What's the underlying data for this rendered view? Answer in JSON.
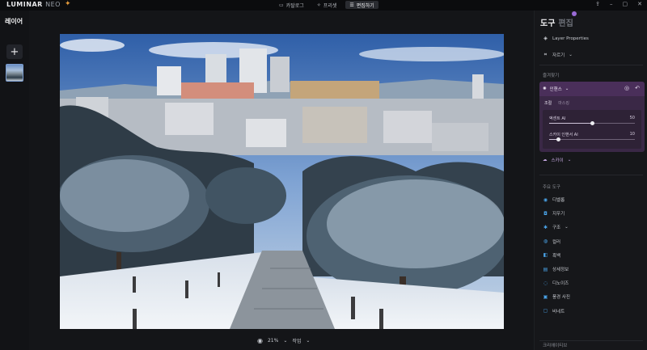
{
  "app": {
    "logo": "LUMINAR",
    "logo_suffix": "NEO"
  },
  "mode_tabs": [
    {
      "label": "카탈로그",
      "icon": "folder-icon"
    },
    {
      "label": "프리셋",
      "icon": "sparkle-icon"
    },
    {
      "label": "편집하기",
      "icon": "sliders-icon",
      "active": true
    }
  ],
  "layers": {
    "title": "레이어"
  },
  "canvas": {
    "zoom": "21%",
    "menu": "작업"
  },
  "right_panel": {
    "tabs": [
      {
        "label": "도구",
        "active": true
      },
      {
        "label": "편집"
      }
    ],
    "layer_properties": "Layer Properties",
    "crop": "자르기",
    "favorites_title": "즐겨찾기",
    "enhance": {
      "label": "인핸스",
      "subtabs": [
        "조절",
        "마스킹"
      ],
      "sliders": [
        {
          "label": "액센트 AI",
          "value": 50,
          "fraction": 0.5
        },
        {
          "label": "스카이 인핸서 AI",
          "value": 10,
          "fraction": 0.1
        }
      ]
    },
    "sky": "스카이",
    "main_tools_title": "주요 도구",
    "main_tools": [
      {
        "label": "디벨롭",
        "icon": "develop-icon",
        "color": "#4aa3e8"
      },
      {
        "label": "지우기",
        "icon": "erase-icon",
        "color": "#4aa3e8"
      },
      {
        "label": "구조",
        "icon": "structure-icon",
        "color": "#4aa3e8"
      },
      {
        "label": "컬러",
        "icon": "color-icon",
        "color": "#4aa3e8"
      },
      {
        "label": "흑백",
        "icon": "bw-icon",
        "color": "#4aa3e8"
      },
      {
        "label": "상세정보",
        "icon": "details-icon",
        "color": "#4aa3e8"
      },
      {
        "label": "디노이즈",
        "icon": "denoise-icon",
        "color": "#4aa3e8"
      },
      {
        "label": "풍경 사진",
        "icon": "landscape-icon",
        "color": "#4aa3e8"
      },
      {
        "label": "비네트",
        "icon": "vignette-icon",
        "color": "#4aa3e8"
      }
    ],
    "creative_title": "크리에이티브"
  }
}
